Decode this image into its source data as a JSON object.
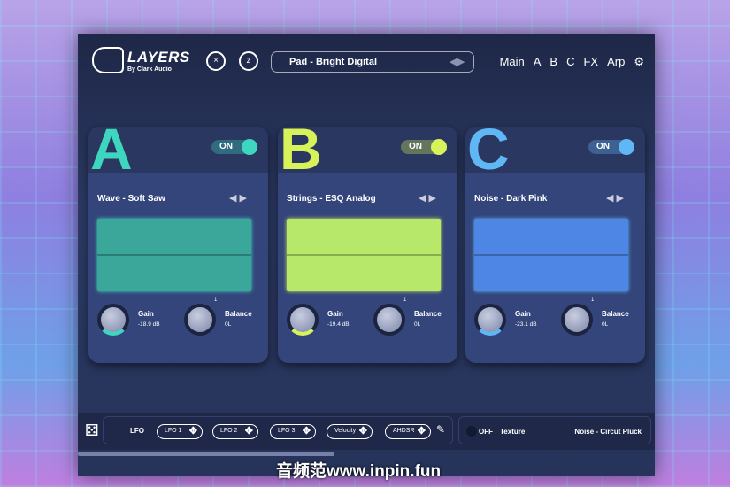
{
  "header": {
    "logo_title": "LAYERS",
    "logo_sub": "By Clark Audio",
    "preset": "Pad - Bright Digital",
    "nav": [
      "Main",
      "A",
      "B",
      "C",
      "FX",
      "Arp"
    ]
  },
  "layers": [
    {
      "letter": "A",
      "toggle": "ON",
      "color": "#3fd6c0",
      "wave_color": "#3aa79a",
      "patch": "Wave - Soft Saw",
      "gain_label": "Gain",
      "gain": "-18.9 dB",
      "balance_label": "Balance",
      "balance": "0L",
      "mark": "1"
    },
    {
      "letter": "B",
      "toggle": "ON",
      "color": "#d8f25a",
      "wave_color": "#b8e86a",
      "patch": "Strings - ESQ Analog",
      "gain_label": "Gain",
      "gain": "-19.4 dB",
      "balance_label": "Balance",
      "balance": "0L",
      "mark": "1"
    },
    {
      "letter": "C",
      "toggle": "ON",
      "color": "#5fb8f5",
      "wave_color": "#4e86e6",
      "patch": "Noise - Dark Pink",
      "gain_label": "Gain",
      "gain": "-23.1 dB",
      "balance_label": "Balance",
      "balance": "0L",
      "mark": "1"
    }
  ],
  "bottom": {
    "lfo_label": "LFO",
    "mods": [
      "LFO 1",
      "LFO 2",
      "LFO 3",
      "Velocity",
      "AHDSR"
    ],
    "texture_toggle": "OFF",
    "texture_label": "Texture",
    "texture_patch": "Noise - Circut Pluck"
  },
  "watermark": "音频范www.inpin.fun"
}
